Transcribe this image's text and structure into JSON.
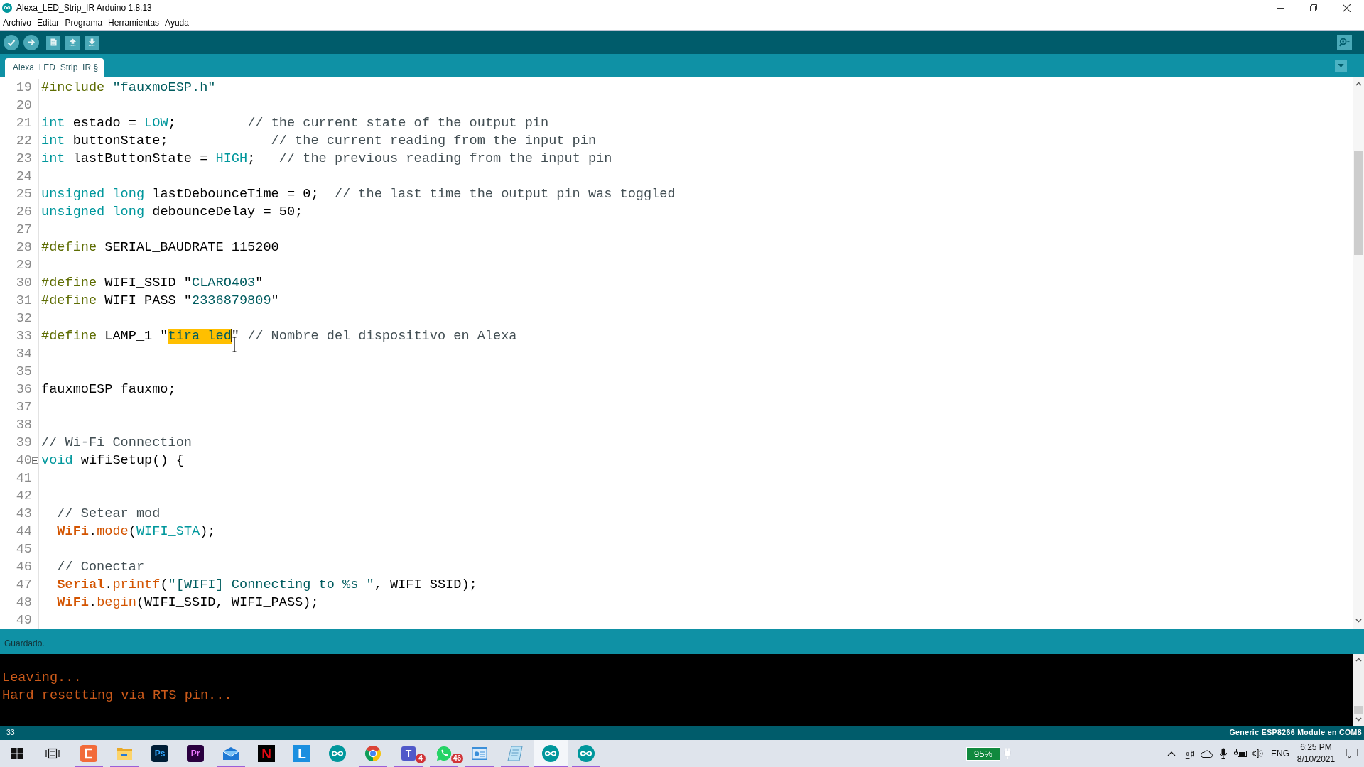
{
  "window": {
    "title": "Alexa_LED_Strip_IR Arduino 1.8.13"
  },
  "menu": [
    "Archivo",
    "Editar",
    "Programa",
    "Herramientas",
    "Ayuda"
  ],
  "tabs": [
    {
      "label": "Alexa_LED_Strip_IR §",
      "selected": true
    }
  ],
  "editor": {
    "lines": [
      {
        "number": "19",
        "fold": false,
        "tokens": [
          {
            "kind": "directive",
            "text": "#include"
          },
          {
            "kind": "string",
            "text": " \"fauxmoESP.h\""
          }
        ]
      },
      {
        "number": "20",
        "fold": false
      },
      {
        "number": "21",
        "fold": false,
        "tokens": [
          {
            "kind": "keyword",
            "text": "int"
          },
          {
            "kind": "plain",
            "text": " estado = "
          },
          {
            "kind": "literal",
            "text": "LOW"
          },
          {
            "kind": "plain",
            "text": ";         "
          },
          {
            "kind": "comment",
            "text": "// the current state of the output pin"
          }
        ]
      },
      {
        "number": "22",
        "fold": false,
        "tokens": [
          {
            "kind": "keyword",
            "text": "int"
          },
          {
            "kind": "plain",
            "text": " buttonState;             "
          },
          {
            "kind": "comment",
            "text": "// the current reading from the input pin"
          }
        ]
      },
      {
        "number": "23",
        "fold": false,
        "tokens": [
          {
            "kind": "keyword",
            "text": "int"
          },
          {
            "kind": "plain",
            "text": " lastButtonState = "
          },
          {
            "kind": "literal",
            "text": "HIGH"
          },
          {
            "kind": "plain",
            "text": ";   "
          },
          {
            "kind": "comment",
            "text": "// the previous reading from the input pin"
          }
        ]
      },
      {
        "number": "24",
        "fold": false
      },
      {
        "number": "25",
        "fold": false,
        "tokens": [
          {
            "kind": "keyword",
            "text": "unsigned long"
          },
          {
            "kind": "plain",
            "text": " lastDebounceTime = 0;  "
          },
          {
            "kind": "comment",
            "text": "// the last time the output pin was toggled"
          }
        ]
      },
      {
        "number": "26",
        "fold": false,
        "tokens": [
          {
            "kind": "keyword",
            "text": "unsigned long"
          },
          {
            "kind": "plain",
            "text": " debounceDelay = 50;"
          }
        ]
      },
      {
        "number": "27",
        "fold": false
      },
      {
        "number": "28",
        "fold": false,
        "tokens": [
          {
            "kind": "directive",
            "text": "#define"
          },
          {
            "kind": "plain",
            "text": " SERIAL_BAUDRATE 115200"
          }
        ]
      },
      {
        "number": "29",
        "fold": false
      },
      {
        "number": "30",
        "fold": false,
        "tokens": [
          {
            "kind": "directive",
            "text": "#define"
          },
          {
            "kind": "plain",
            "text": " WIFI_SSID \""
          },
          {
            "kind": "string",
            "text": "CLARO403"
          },
          {
            "kind": "plain",
            "text": "\""
          }
        ]
      },
      {
        "number": "31",
        "fold": false,
        "tokens": [
          {
            "kind": "directive",
            "text": "#define"
          },
          {
            "kind": "plain",
            "text": " WIFI_PASS \""
          },
          {
            "kind": "string",
            "text": "2336879809"
          },
          {
            "kind": "plain",
            "text": "\""
          }
        ]
      },
      {
        "number": "32",
        "fold": false
      },
      {
        "number": "33",
        "fold": false,
        "tokens": [
          {
            "kind": "directive",
            "text": "#define"
          },
          {
            "kind": "plain",
            "text": " LAMP_1 \""
          },
          {
            "kind": "selection",
            "text": "tira led"
          },
          {
            "kind": "caret"
          },
          {
            "kind": "plain",
            "text": "\" "
          },
          {
            "kind": "comment",
            "text": "// Nombre del dispositivo en Alexa"
          }
        ]
      },
      {
        "number": "34",
        "fold": false
      },
      {
        "number": "35",
        "fold": false
      },
      {
        "number": "36",
        "fold": false,
        "tokens": [
          {
            "kind": "plain",
            "text": "fauxmoESP fauxmo;"
          }
        ]
      },
      {
        "number": "37",
        "fold": false
      },
      {
        "number": "38",
        "fold": false
      },
      {
        "number": "39",
        "fold": false,
        "tokens": [
          {
            "kind": "comment",
            "text": "// Wi-Fi Connection"
          }
        ]
      },
      {
        "number": "40",
        "fold": true,
        "tokens": [
          {
            "kind": "keyword",
            "text": "void"
          },
          {
            "kind": "plain",
            "text": " wifiSetup() {"
          }
        ]
      },
      {
        "number": "41",
        "fold": false
      },
      {
        "number": "42",
        "fold": false
      },
      {
        "number": "43",
        "fold": false,
        "tokens": [
          {
            "kind": "comment",
            "text": "  // Setear mod"
          }
        ]
      },
      {
        "number": "44",
        "fold": false,
        "tokens": [
          {
            "kind": "class",
            "text": "  WiFi"
          },
          {
            "kind": "plain",
            "text": "."
          },
          {
            "kind": "method",
            "text": "mode"
          },
          {
            "kind": "plain",
            "text": "("
          },
          {
            "kind": "literal",
            "text": "WIFI_STA"
          },
          {
            "kind": "plain",
            "text": ");"
          }
        ]
      },
      {
        "number": "45",
        "fold": false
      },
      {
        "number": "46",
        "fold": false,
        "tokens": [
          {
            "kind": "comment",
            "text": "  // Conectar"
          }
        ]
      },
      {
        "number": "47",
        "fold": false,
        "tokens": [
          {
            "kind": "class",
            "text": "  Serial"
          },
          {
            "kind": "plain",
            "text": "."
          },
          {
            "kind": "method",
            "text": "printf"
          },
          {
            "kind": "plain",
            "text": "("
          },
          {
            "kind": "string",
            "text": "\"[WIFI] Connecting to %s \""
          },
          {
            "kind": "plain",
            "text": ", WIFI_SSID);"
          }
        ]
      },
      {
        "number": "48",
        "fold": false,
        "tokens": [
          {
            "kind": "class",
            "text": "  WiFi"
          },
          {
            "kind": "plain",
            "text": "."
          },
          {
            "kind": "method",
            "text": "begin"
          },
          {
            "kind": "plain",
            "text": "(WIFI_SSID, WIFI_PASS);"
          }
        ]
      },
      {
        "number": "49",
        "fold": false
      }
    ]
  },
  "status_message": "Guardado.",
  "console": {
    "lines": [
      "Leaving...",
      "Hard resetting via RTS pin..."
    ]
  },
  "status_bar": {
    "line": "33",
    "board": "Generic ESP8266 Module en COM8"
  },
  "taskbar": {
    "items": [
      {
        "kind": "windows",
        "running": false,
        "selected": false
      },
      {
        "kind": "taskview",
        "running": false,
        "selected": false
      },
      {
        "kind": "bracket",
        "running": true,
        "selected": false
      },
      {
        "kind": "folder",
        "running": true,
        "selected": false
      },
      {
        "kind": "navy_tile",
        "text": "Ps",
        "running": false,
        "selected": false
      },
      {
        "kind": "plum_tile",
        "text": "Pr",
        "running": false,
        "selected": false
      },
      {
        "kind": "mail",
        "running": true,
        "selected": false
      },
      {
        "kind": "black_tile",
        "text": "N",
        "running": false,
        "selected": false
      },
      {
        "kind": "blue_tile",
        "text": "L",
        "running": false,
        "selected": false
      },
      {
        "kind": "arduino",
        "running": false,
        "selected": false
      },
      {
        "kind": "browser",
        "running": true,
        "selected": false
      },
      {
        "kind": "violet_tile",
        "text": "T",
        "badge": "4",
        "running": true,
        "selected": false
      },
      {
        "kind": "chat",
        "badge": "46",
        "running": true,
        "selected": false
      },
      {
        "kind": "panel",
        "running": true,
        "selected": false
      },
      {
        "kind": "notepad",
        "running": true,
        "selected": false
      },
      {
        "kind": "arduino",
        "running": true,
        "selected": true
      },
      {
        "kind": "arduino",
        "running": true,
        "selected": false
      }
    ],
    "battery": "95%",
    "language": "ENG",
    "time": "6:25 PM",
    "date": "8/10/2021"
  }
}
